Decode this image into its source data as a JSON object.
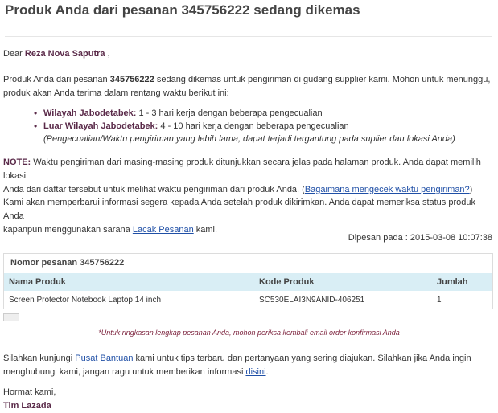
{
  "title": "Produk Anda dari pesanan 345756222 sedang dikemas",
  "greeting": {
    "prefix": "Dear ",
    "name": "Reza Nova Saputra",
    "suffix": " ,"
  },
  "intro": {
    "line1_pre": "Produk Anda dari pesanan ",
    "order_no": "345756222",
    "line1_post": " sedang dikemas untuk pengiriman di gudang supplier kami. Mohon untuk menunggu,",
    "line2": "produk akan Anda terima dalam rentang waktu berikut ini:"
  },
  "bullets": [
    {
      "label": "Wilayah Jabodetabek:",
      "text": " 1 - 3 hari kerja dengan beberapa pengecualian"
    },
    {
      "label": "Luar Wilayah Jabodetabek:",
      "text": " 4 - 10 hari kerja dengan beberapa pengecualian"
    }
  ],
  "bullet_note": "(Pengecualian/Waktu pengiriman yang lebih lama, dapat terjadi tergantung pada suplier dan lokasi Anda)",
  "note": {
    "label": "NOTE:",
    "line1": " Waktu pengiriman dari masing-masing produk ditunjukkan secara jelas pada halaman produk. Anda dapat memilih lokasi",
    "line2_pre": "Anda dari daftar tersebut untuk melihat waktu pengiriman dari produk Anda. (",
    "link": "Bagaimana mengecek waktu pengiriman?",
    "line2_post": ")"
  },
  "update": {
    "line1": "Kami akan memperbarui informasi segera kepada Anda setelah produk dikirimkan. Anda dapat memeriksa status produk Anda",
    "line2_pre": "kapanpun menggunakan sarana ",
    "link": "Lacak Pesanan",
    "line2_post": " kami."
  },
  "dipesan": "Dipesan pada : 2015-03-08 10:07:38",
  "order_table": {
    "heading": "Nomor pesanan 345756222",
    "columns": [
      "Nama Produk",
      "Kode Produk",
      "Jumlah"
    ],
    "rows": [
      [
        "Screen Protector Notebook Laptop 14 inch",
        "SC530ELAI3N9ANID-406251",
        "1"
      ]
    ]
  },
  "more_label": "···",
  "summary_note": "*Untuk ringkasan lengkap pesanan Anda, mohon periksa kembali email order konfirmasi Anda",
  "help": {
    "line1_pre": "Silahkan kunjungi ",
    "link1": "Pusat Bantuan",
    "line1_post": " kami untuk tips terbaru dan pertanyaan yang sering diajukan. Silahkan jika Anda ingin",
    "line2_pre": "menghubungi kami, jangan ragu untuk memberikan informasi ",
    "link2": "disini",
    "line2_post": "."
  },
  "signoff": {
    "line1": "Hormat kami,",
    "line2": "Tim Lazada"
  }
}
